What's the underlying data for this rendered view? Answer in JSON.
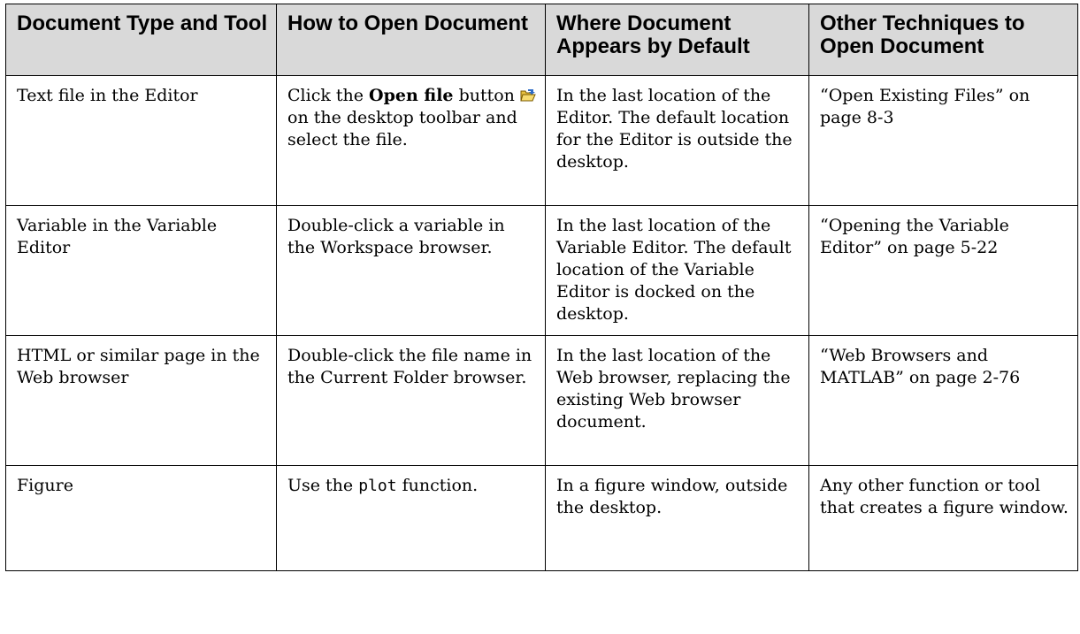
{
  "headers": [
    "Document Type and Tool",
    "How to Open Document",
    "Where Document Appears by Default",
    "Other Techniques to Open Document"
  ],
  "rows": [
    {
      "type": "Text file in the Editor",
      "how_pre": "Click the ",
      "how_bold": "Open file",
      "how_mid": " button ",
      "how_icon": "open-folder-icon",
      "how_post": " on the desktop toolbar and select the file.",
      "where": "In the last location of the Editor.  The default location for the Editor is outside the desktop.",
      "other": "“Open Existing Files” on page 8-3"
    },
    {
      "type": "Variable in the Variable Editor",
      "how": "Double-click a variable in the Workspace browser.",
      "where": "In the last location of the Variable Editor. The default location of the Variable Editor is docked on the desktop.",
      "other": "“Opening the Variable Editor” on page 5-22"
    },
    {
      "type": "HTML or similar page in the Web browser",
      "how": "Double-click the file name in the Current Folder browser.",
      "where": "In the last location of the Web browser, replacing the existing Web browser document.",
      "other": "“Web Browsers and MATLAB” on page 2-76"
    },
    {
      "type": "Figure",
      "how_pre": "Use the ",
      "how_code": "plot",
      "how_post": " function.",
      "where": "In a figure window, outside the desktop.",
      "other": "Any other function or tool that creates a figure window."
    }
  ]
}
